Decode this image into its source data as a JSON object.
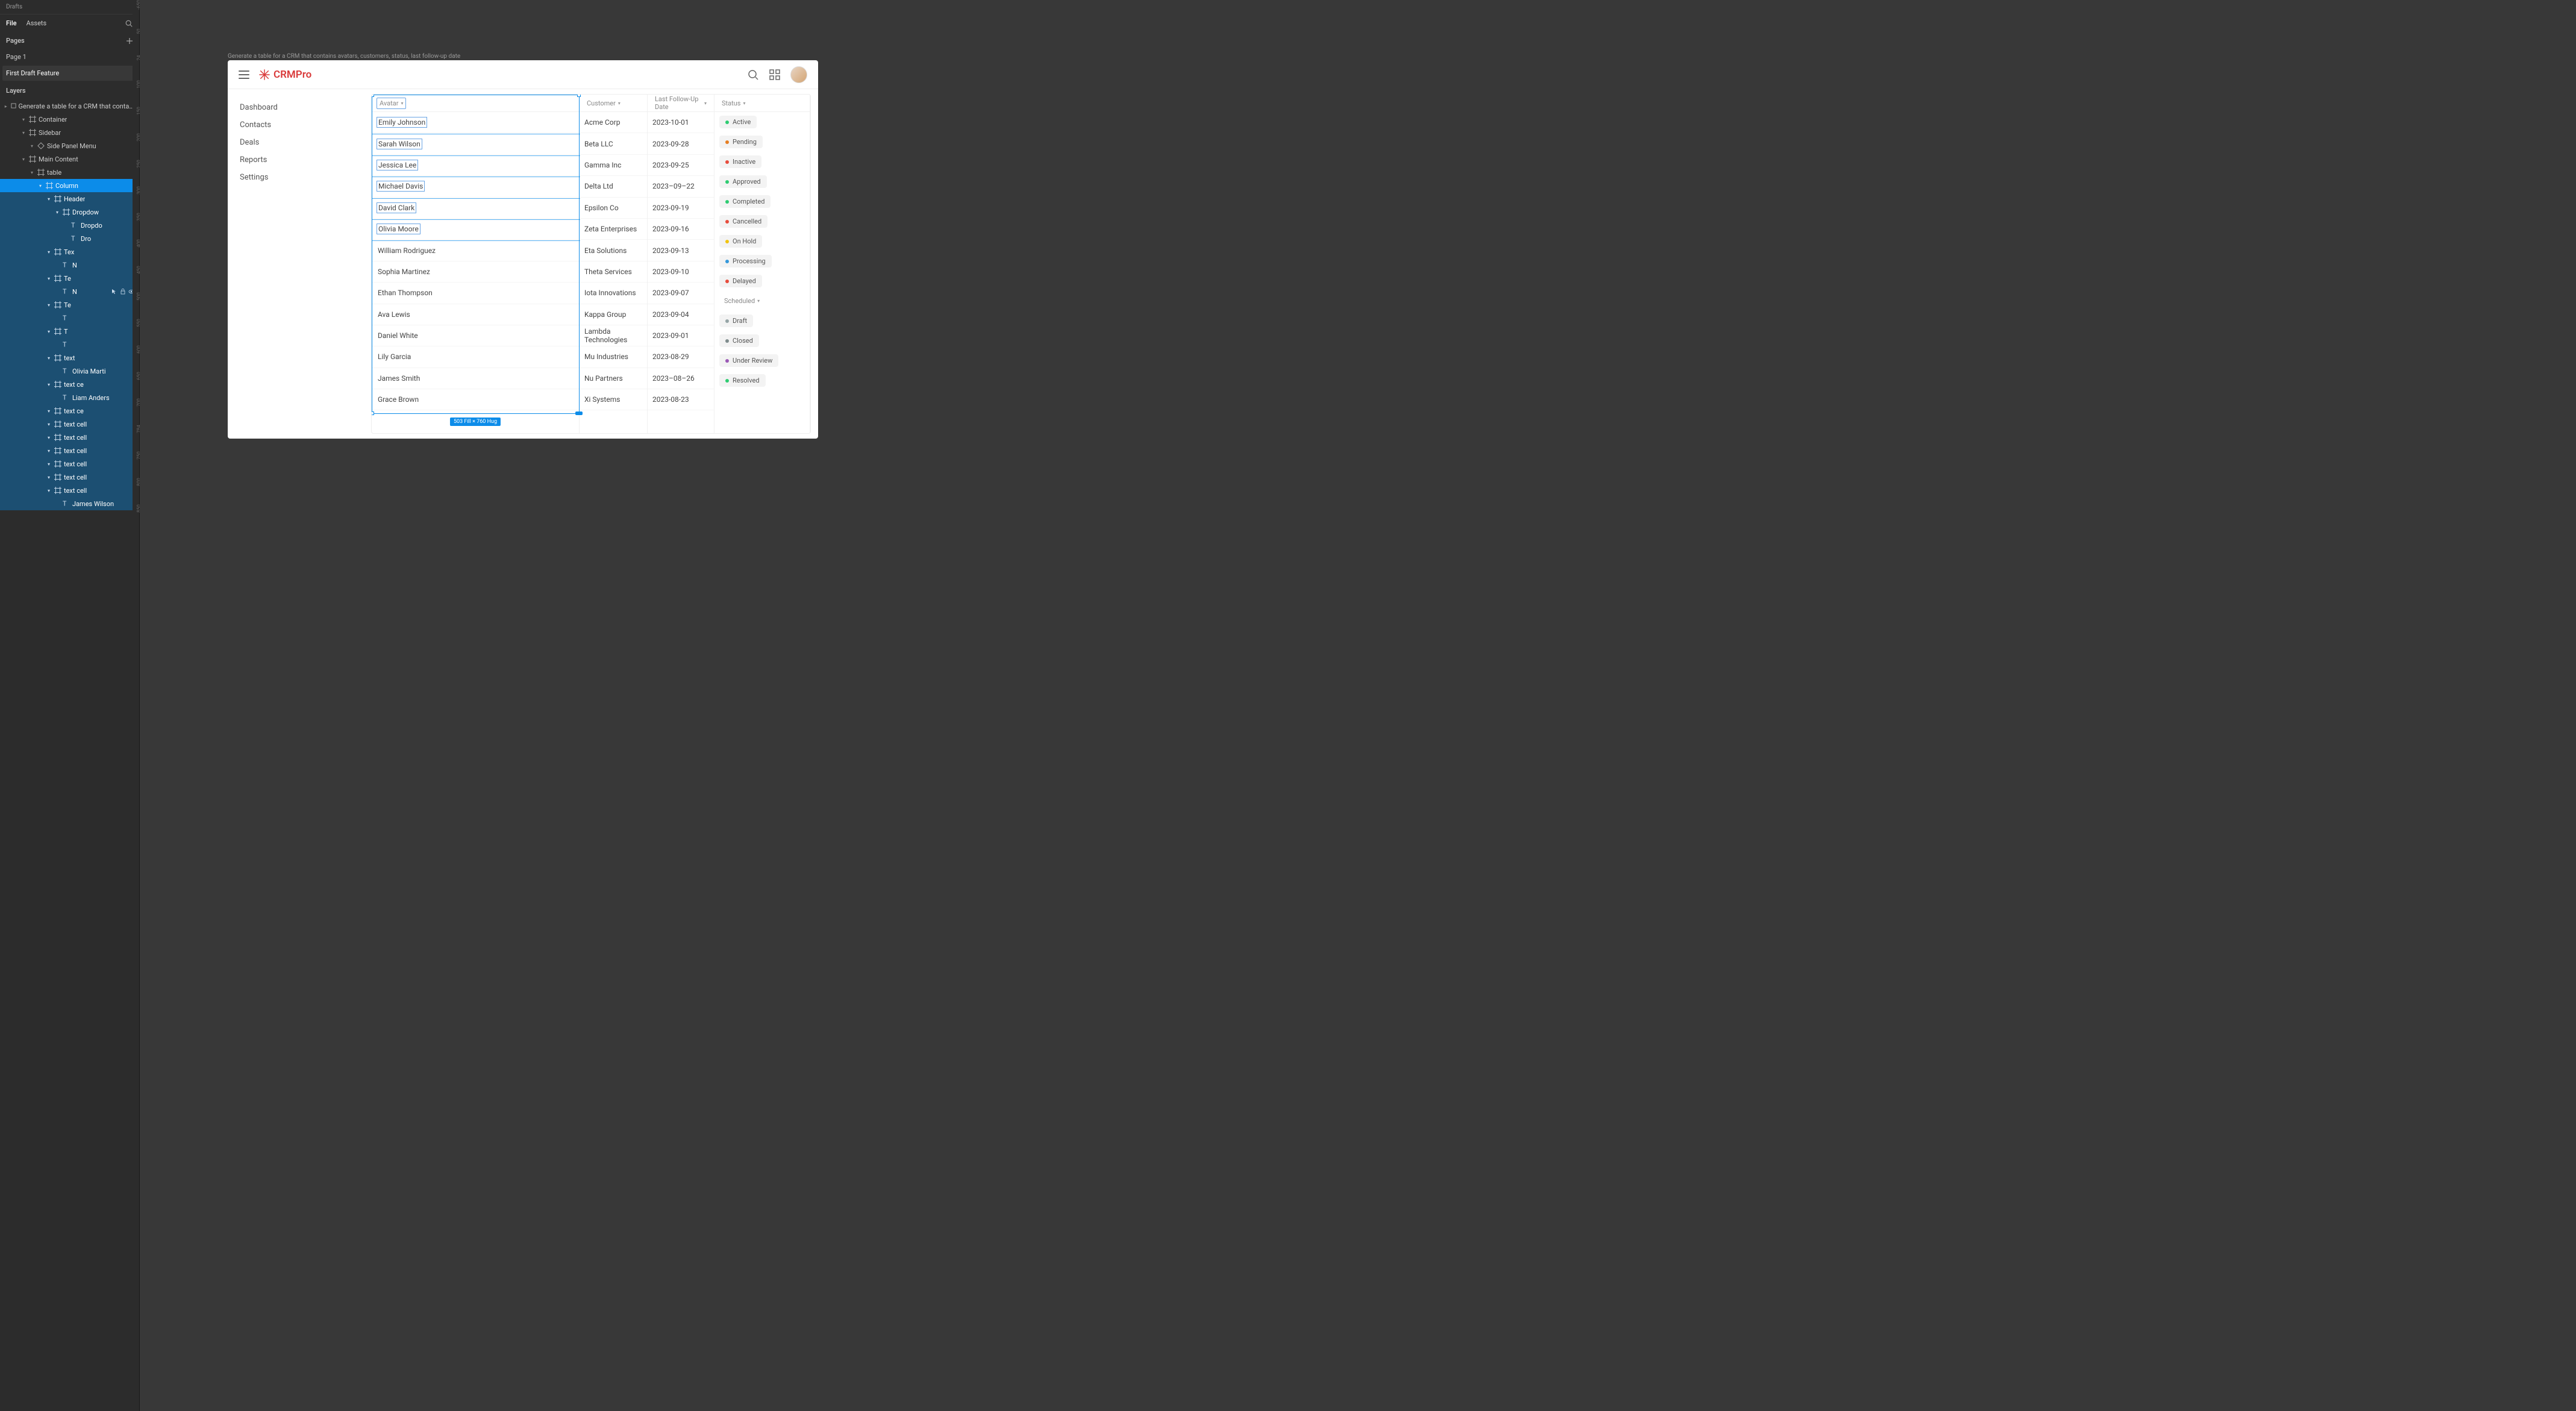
{
  "figma": {
    "breadcrumb": "Drafts",
    "tabs": {
      "file": "File",
      "assets": "Assets"
    },
    "pages_header": "Pages",
    "pages": [
      "Page 1",
      "First Draft Feature"
    ],
    "layers_header": "Layers",
    "layer_root": "Generate a table for a CRM that contains avatars, c...",
    "layers": [
      {
        "indent": 2,
        "icon": "frame",
        "label": "Container",
        "sel": false
      },
      {
        "indent": 2,
        "icon": "frame",
        "label": "Sidebar",
        "sel": false
      },
      {
        "indent": 3,
        "icon": "instance",
        "label": "Side Panel Menu",
        "sel": false
      },
      {
        "indent": 2,
        "icon": "frame",
        "label": "Main Content",
        "sel": false
      },
      {
        "indent": 3,
        "icon": "frame",
        "label": "table",
        "sel": false
      },
      {
        "indent": 4,
        "icon": "frame",
        "label": "Column",
        "sel": true
      },
      {
        "indent": 5,
        "icon": "frame",
        "label": "Header",
        "sel": false,
        "selrange": true
      },
      {
        "indent": 6,
        "icon": "frame",
        "label": "Dropdow",
        "sel": false,
        "selrange": true
      },
      {
        "indent": 7,
        "icon": "text",
        "label": "Dropdo",
        "sel": false,
        "selrange": true
      },
      {
        "indent": 7,
        "icon": "text",
        "label": "Dro",
        "sel": false,
        "selrange": true
      },
      {
        "indent": 5,
        "icon": "frame",
        "label": "Tex",
        "sel": false,
        "selrange": true
      },
      {
        "indent": 6,
        "icon": "text",
        "label": "N",
        "sel": false,
        "selrange": true
      },
      {
        "indent": 5,
        "icon": "frame",
        "label": "Te",
        "sel": false,
        "selrange": true
      },
      {
        "indent": 6,
        "icon": "text",
        "label": "N",
        "sel": false,
        "selrange": true,
        "hover": true
      },
      {
        "indent": 5,
        "icon": "frame",
        "label": "Te",
        "sel": false,
        "selrange": true
      },
      {
        "indent": 6,
        "icon": "text",
        "label": "",
        "sel": false,
        "selrange": true
      },
      {
        "indent": 5,
        "icon": "frame",
        "label": "T",
        "sel": false,
        "selrange": true
      },
      {
        "indent": 6,
        "icon": "text",
        "label": "",
        "sel": false,
        "selrange": true
      },
      {
        "indent": 5,
        "icon": "frame",
        "label": "text",
        "sel": false,
        "selrange": true
      },
      {
        "indent": 6,
        "icon": "text",
        "label": "Olivia Marti",
        "sel": false,
        "selrange": true
      },
      {
        "indent": 5,
        "icon": "frame",
        "label": "text ce",
        "sel": false,
        "selrange": true
      },
      {
        "indent": 6,
        "icon": "text",
        "label": "Liam Anders",
        "sel": false,
        "selrange": true
      },
      {
        "indent": 5,
        "icon": "frame",
        "label": "text ce",
        "sel": false,
        "selrange": true
      },
      {
        "indent": 5,
        "icon": "frame",
        "label": "text cell",
        "sel": false,
        "selrange": true
      },
      {
        "indent": 5,
        "icon": "frame",
        "label": "text cell",
        "sel": false,
        "selrange": true
      },
      {
        "indent": 5,
        "icon": "frame",
        "label": "text cell",
        "sel": false,
        "selrange": true
      },
      {
        "indent": 5,
        "icon": "frame",
        "label": "text cell",
        "sel": false,
        "selrange": true
      },
      {
        "indent": 5,
        "icon": "frame",
        "label": "text cell",
        "sel": false,
        "selrange": true
      },
      {
        "indent": 5,
        "icon": "frame",
        "label": "text cell",
        "sel": false,
        "selrange": true
      },
      {
        "indent": 6,
        "icon": "text",
        "label": "James Wilson",
        "sel": false,
        "selrange": true
      }
    ],
    "ruler_ticks": [
      "-650",
      "50",
      "24",
      "100",
      "150",
      "200",
      "250",
      "300",
      "350",
      "400",
      "450",
      "500",
      "550",
      "600",
      "650",
      "700",
      "784",
      "750",
      "800",
      "850"
    ],
    "canvas_caption": "Generate a table for a CRM that contains avatars, customers, status,  last follow-up date",
    "selection_badge": "503 Fill × 760 Hug"
  },
  "crm": {
    "brand": "CRMPro",
    "nav": [
      "Dashboard",
      "Contacts",
      "Deals",
      "Reports",
      "Settings"
    ],
    "columns": {
      "avatar": "Avatar",
      "customer": "Customer",
      "date": "Last Follow-Up Date",
      "status": "Status"
    },
    "rows": [
      {
        "name": "Emily Johnson",
        "customer": "Acme Corp",
        "date": "2023-10-01",
        "status": "Active",
        "color": "#2ecc71",
        "boxed": true
      },
      {
        "name": "Sarah Wilson",
        "customer": "Beta LLC",
        "date": "2023-09-28",
        "status": "Pending",
        "color": "#e67e22",
        "boxed": true
      },
      {
        "name": "Jessica Lee",
        "customer": "Gamma Inc",
        "date": "2023-09-25",
        "status": "Inactive",
        "color": "#e74c3c",
        "boxed": true
      },
      {
        "name": "Michael Davis",
        "customer": "Delta Ltd",
        "date": "2023–09–22",
        "status": "Approved",
        "color": "#2ecc71",
        "boxed": true
      },
      {
        "name": "David Clark",
        "customer": "Epsilon Co",
        "date": "2023-09-19",
        "status": "Completed",
        "color": "#2ecc71",
        "boxed": true
      },
      {
        "name": "Olivia Moore",
        "customer": "Zeta Enterprises",
        "date": "2023-09-16",
        "status": "Cancelled",
        "color": "#e74c3c",
        "boxed": true
      },
      {
        "name": "William Rodriguez",
        "customer": "Eta Solutions",
        "date": "2023-09-13",
        "status": "On Hold",
        "color": "#f1c40f",
        "boxed": false
      },
      {
        "name": "Sophia Martinez",
        "customer": "Theta Services",
        "date": "2023-09-10",
        "status": "Processing",
        "color": "#3498db",
        "boxed": false
      },
      {
        "name": "Ethan Thompson",
        "customer": "Iota Innovations",
        "date": "2023-09-07",
        "status": "Delayed",
        "color": "#e74c3c",
        "boxed": false
      },
      {
        "name": "Ava Lewis",
        "customer": "Kappa Group",
        "date": "2023-09-04",
        "status": "",
        "color": "",
        "scheduled_header": true,
        "boxed": false
      },
      {
        "name": "Daniel White",
        "customer": "Lambda Technologies",
        "date": "2023-09-01",
        "status": "Draft",
        "color": "#95a5a6",
        "boxed": false
      },
      {
        "name": "Lily Garcia",
        "customer": "Mu Industries",
        "date": "2023-08-29",
        "status": "Closed",
        "color": "#7f8c8d",
        "boxed": false
      },
      {
        "name": "James Smith",
        "customer": "Nu Partners",
        "date": "2023–08–26",
        "status": "Under Review",
        "color": "#9b59b6",
        "boxed": false
      },
      {
        "name": "Grace Brown",
        "customer": "Xi Systems",
        "date": "2023-08-23",
        "status": "Resolved",
        "color": "#2ecc71",
        "boxed": false
      }
    ],
    "scheduled_label": "Scheduled"
  }
}
